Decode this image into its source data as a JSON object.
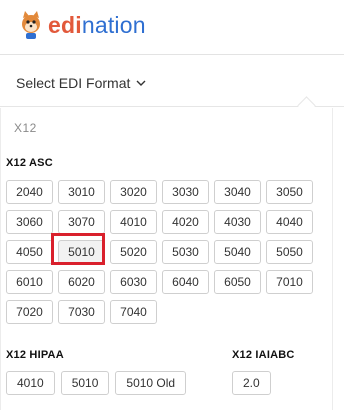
{
  "header": {
    "brand_edi": "edi",
    "brand_nation": "nation",
    "logo_icon": "fox-mascot-icon"
  },
  "format_select": {
    "label": "Select EDI Format",
    "icon": "chevron-down-icon"
  },
  "section": {
    "label": "X12"
  },
  "groups": {
    "asc": {
      "title": "X12 ASC",
      "versions": [
        "2040",
        "3010",
        "3020",
        "3030",
        "3040",
        "3050",
        "3060",
        "3070",
        "4010",
        "4020",
        "4030",
        "4040",
        "4050",
        "5010",
        "5020",
        "5030",
        "5040",
        "5050",
        "6010",
        "6020",
        "6030",
        "6040",
        "6050",
        "7010",
        "7020",
        "7030",
        "7040"
      ],
      "selected": "5010"
    },
    "hipaa": {
      "title": "X12 HIPAA",
      "versions": [
        "4010",
        "5010",
        "5010 Old"
      ]
    },
    "iaiabc": {
      "title": "X12 IAIABC",
      "versions": [
        "2.0"
      ]
    }
  },
  "colors": {
    "brand_orange": "#e2593b",
    "brand_blue": "#2f6fd1",
    "highlight_red": "#d9202c"
  }
}
